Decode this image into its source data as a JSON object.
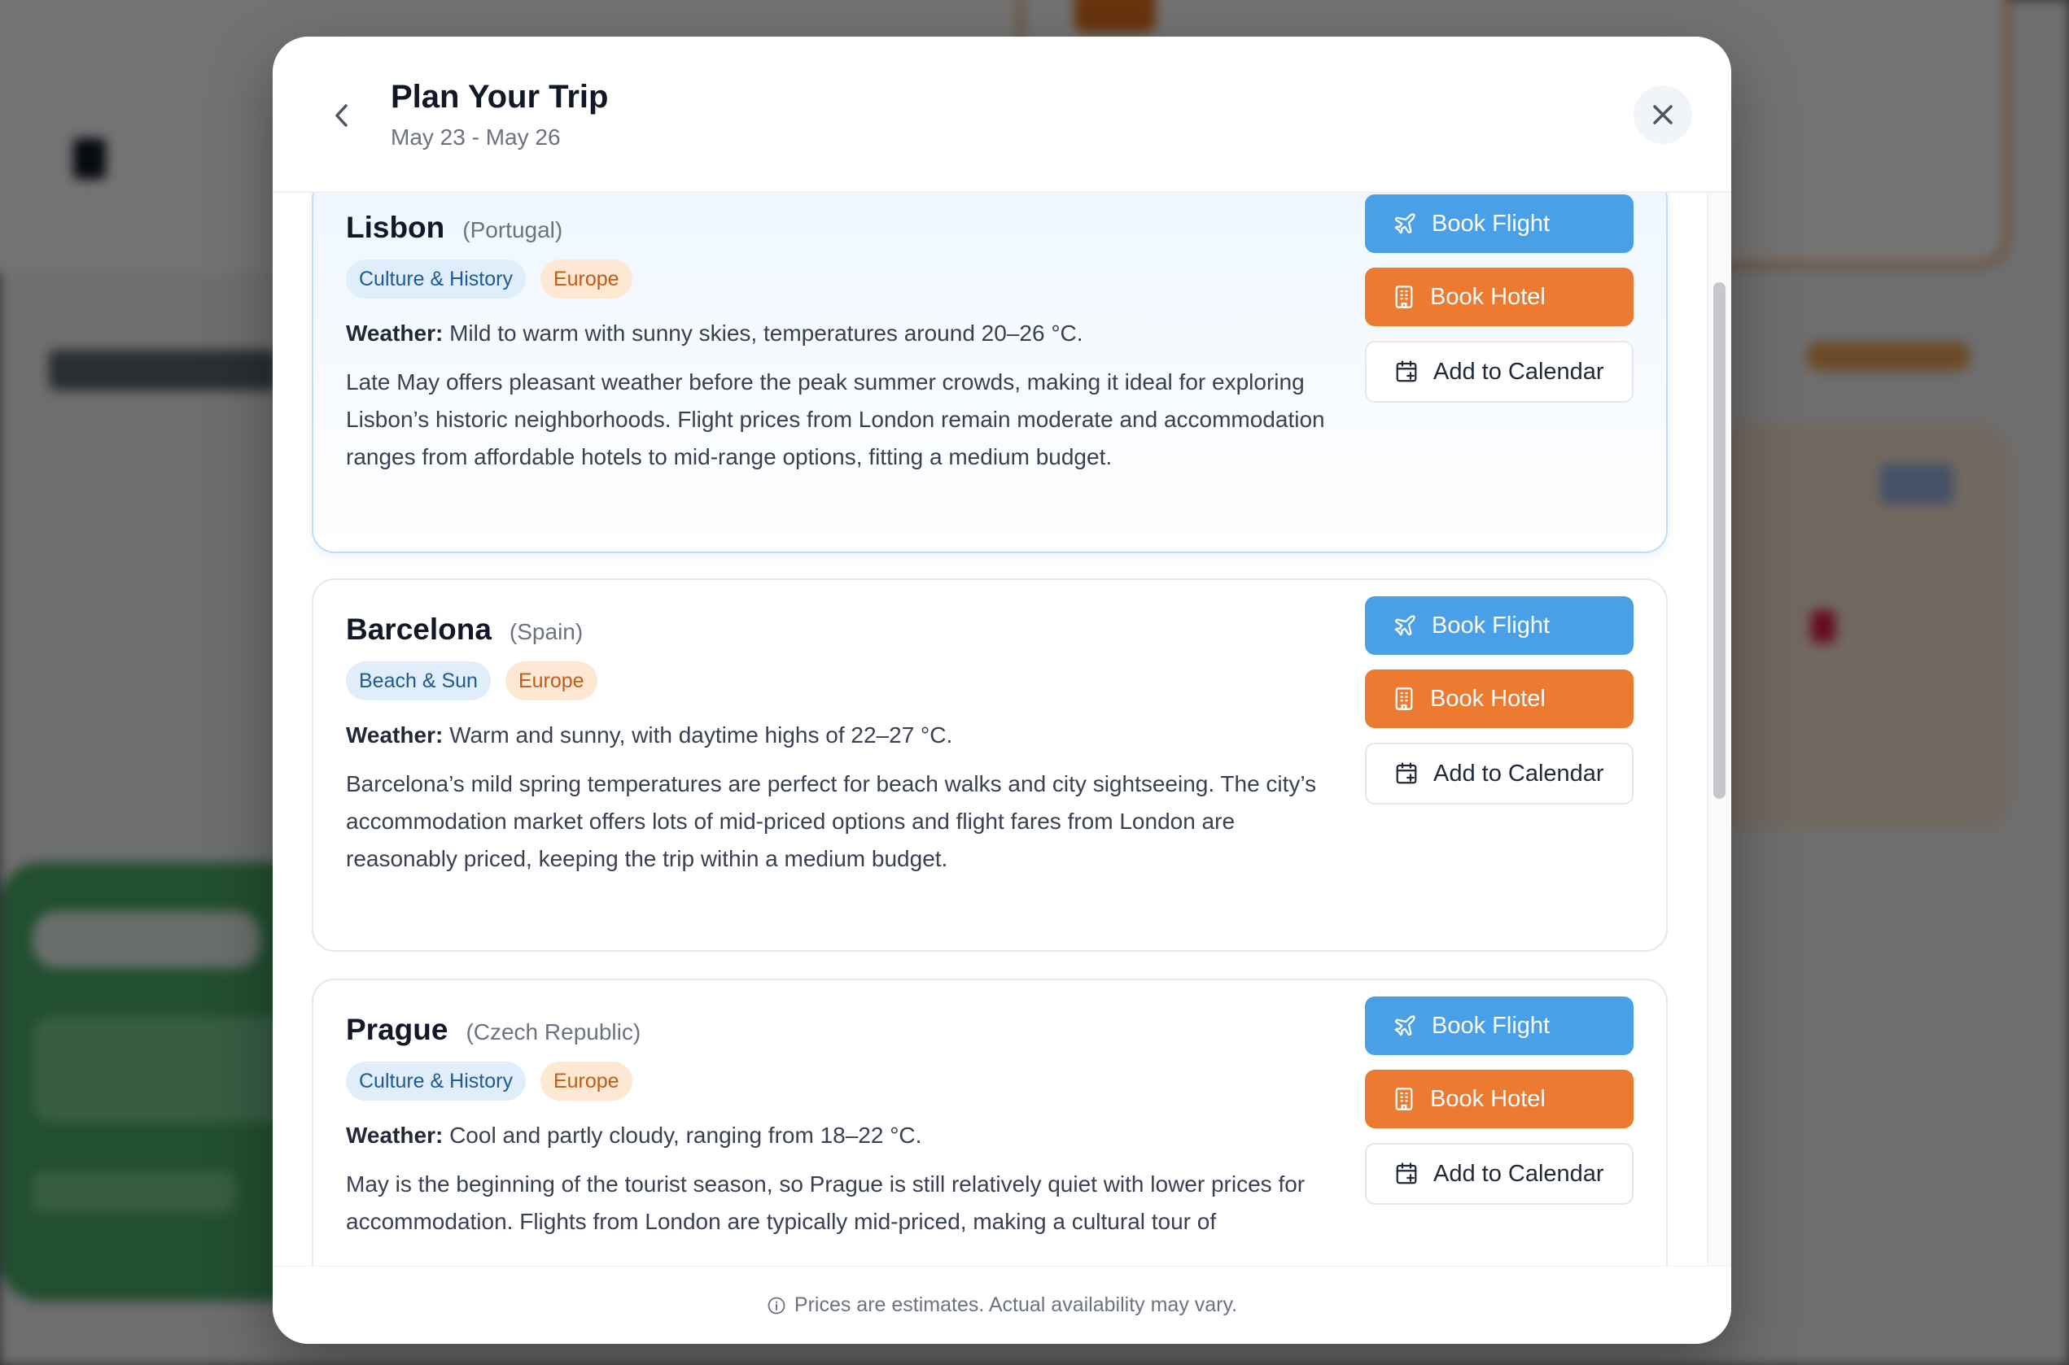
{
  "header": {
    "title": "Plan Your Trip",
    "dates": "May 23 - May 26",
    "back_icon": "chevron-left-icon",
    "close_icon": "close-icon"
  },
  "buttons": {
    "flight": "Book Flight",
    "hotel": "Book Hotel",
    "calendar": "Add to Calendar"
  },
  "weather_label": "Weather:",
  "destinations": [
    {
      "city": "Lisbon",
      "country": "(Portugal)",
      "tags": [
        "Culture & History",
        "Europe"
      ],
      "weather": "Mild to warm with sunny skies, temperatures around 20–26 °C.",
      "description": "Late May offers pleasant weather before the peak summer crowds, making it ideal for exploring Lisbon’s historic neighborhoods. Flight prices from London remain moderate and accommodation ranges from affordable hotels to mid-range options, fitting a medium budget."
    },
    {
      "city": "Barcelona",
      "country": "(Spain)",
      "tags": [
        "Beach & Sun",
        "Europe"
      ],
      "weather": "Warm and sunny, with daytime highs of 22–27 °C.",
      "description": "Barcelona’s mild spring temperatures are perfect for beach walks and city sightseeing. The city’s accommodation market offers lots of mid-priced options and flight fares from London are reasonably priced, keeping the trip within a medium budget."
    },
    {
      "city": "Prague",
      "country": "(Czech Republic)",
      "tags": [
        "Culture & History",
        "Europe"
      ],
      "weather": "Cool and partly cloudy, ranging from 18–22 °C.",
      "description": "May is the beginning of the tourist season, so Prague is still relatively quiet with lower prices for accommodation. Flights from London are typically mid-priced, making a cultural tour of"
    }
  ],
  "footer": {
    "note": "Prices are estimates. Actual availability may vary.",
    "icon": "info-icon"
  },
  "colors": {
    "flight_button": "#4aa0e6",
    "hotel_button": "#ec7a31",
    "tag_blue_bg": "#e0edfb",
    "tag_orange_bg": "#fde8d3"
  }
}
